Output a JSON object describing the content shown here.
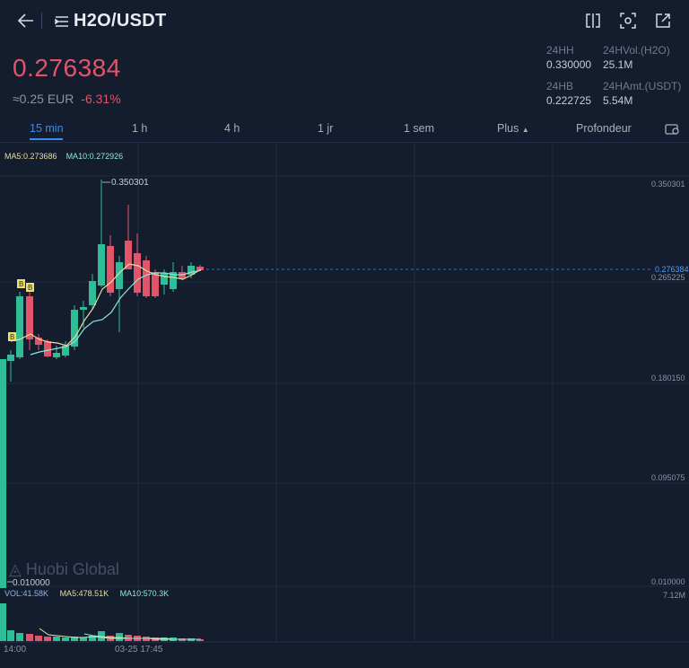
{
  "header": {
    "title": "H2O/USDT",
    "back_icon": "arrow-left-icon",
    "menu_icon": "menu-icon",
    "actions": [
      "split-view-icon",
      "screenshot-icon",
      "share-icon"
    ]
  },
  "ticker": {
    "price": "0.276384",
    "fiat": "≈0.25 EUR",
    "change": "-6.31%"
  },
  "stats": {
    "high_label": "24HH",
    "high_value": "0.330000",
    "vol_label": "24HVol.(H2O)",
    "vol_value": "25.1M",
    "low_label": "24HB",
    "low_value": "0.222725",
    "amt_label": "24HAmt.(USDT)",
    "amt_value": "5.54M"
  },
  "tabs": {
    "t15": "15 min",
    "t1h": "1 h",
    "t4h": "4 h",
    "t1d": "1 jr",
    "t1w": "1 sem",
    "more": "Plus",
    "depth": "Profondeur",
    "settings_icon": "chart-settings-icon"
  },
  "chart": {
    "ma5": "MA5:0.273686",
    "ma10": "MA10:0.272926",
    "axis": [
      "0.350301",
      "0.265225",
      "0.180150",
      "0.095075",
      "0.010000"
    ],
    "current_label": "0.276384",
    "high_mark": "0.350301",
    "low_mark": "0.010000",
    "buy_marker": "B",
    "watermark": "Huobi Global",
    "vol": "VOL:41.58K",
    "vol_ma5": "MA5:478.51K",
    "vol_ma10": "MA10:570.3K",
    "vol_max": "7.12M",
    "time_left": "14:00",
    "time_mid": "03-25 17:45",
    "colors": {
      "up": "#2ebd97",
      "down": "#e0556a",
      "ma5": "#e8dfa0",
      "ma10": "#8fe6d8",
      "accent": "#3a8cf0"
    }
  }
}
